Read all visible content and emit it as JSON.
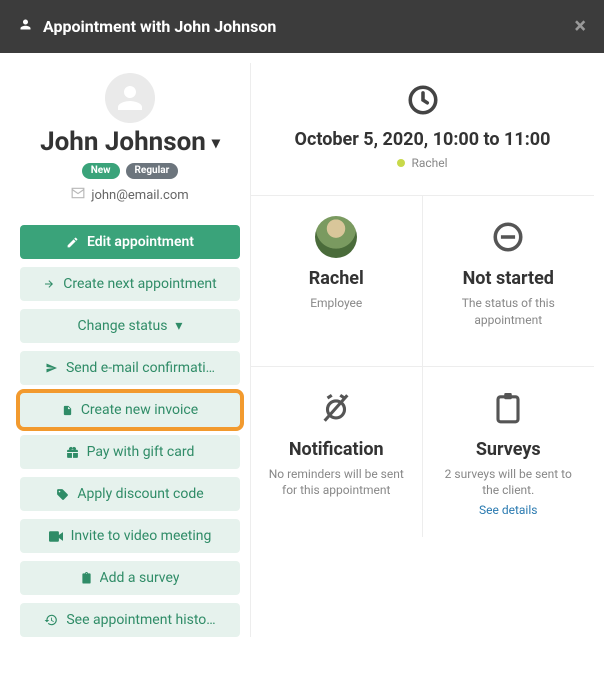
{
  "header": {
    "title": "Appointment with John Johnson"
  },
  "client": {
    "name": "John Johnson",
    "badge_new": "New",
    "badge_regular": "Regular",
    "email": "john@email.com"
  },
  "actions": {
    "edit": "Edit appointment",
    "create_next": "Create next appointment",
    "change_status": "Change status",
    "send_email": "Send e-mail confirmati…",
    "create_invoice": "Create new invoice",
    "pay_gift": "Pay with gift card",
    "discount": "Apply discount code",
    "video": "Invite to video meeting",
    "survey": "Add a survey",
    "history": "See appointment histo…"
  },
  "schedule": {
    "date_time": "October 5, 2020, 10:00 to 11:00",
    "employee_chip": "Rachel"
  },
  "cards": {
    "employee": {
      "title": "Rachel",
      "subtitle": "Employee"
    },
    "status": {
      "title": "Not started",
      "subtitle": "The status of this appointment"
    },
    "notification": {
      "title": "Notification",
      "subtitle": "No reminders will be sent for this appointment"
    },
    "surveys": {
      "title": "Surveys",
      "subtitle": "2 surveys will be sent to the client.",
      "link": "See details"
    }
  }
}
